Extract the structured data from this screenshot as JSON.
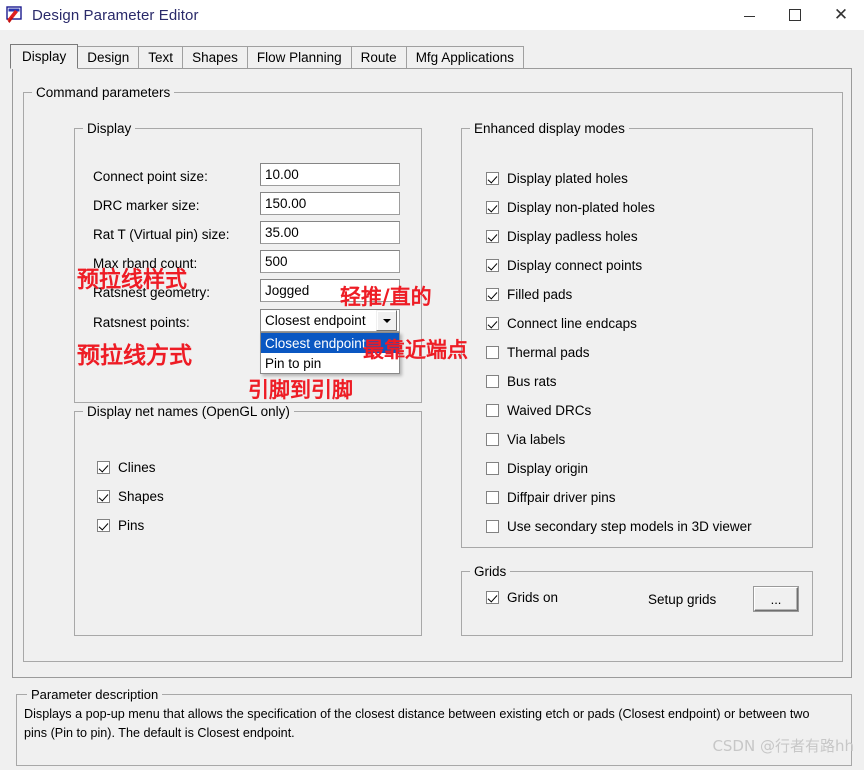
{
  "window": {
    "title": "Design Parameter Editor",
    "icon": "app-icon",
    "minimize_label": "—",
    "maximize_label": "□",
    "close_label": "✕"
  },
  "tabs": [
    {
      "label": "Display",
      "active": true
    },
    {
      "label": "Design",
      "active": false
    },
    {
      "label": "Text",
      "active": false
    },
    {
      "label": "Shapes",
      "active": false
    },
    {
      "label": "Flow Planning",
      "active": false
    },
    {
      "label": "Route",
      "active": false
    },
    {
      "label": "Mfg Applications",
      "active": false
    }
  ],
  "command_parameters": {
    "legend": "Command parameters",
    "display_group": {
      "legend": "Display",
      "fields": [
        {
          "label": "Connect point size:",
          "value": "10.00"
        },
        {
          "label": "DRC marker size:",
          "value": "150.00"
        },
        {
          "label": "Rat T (Virtual pin) size:",
          "value": "35.00"
        },
        {
          "label": "Max rband count:",
          "value": "500"
        },
        {
          "label": "Ratsnest geometry:",
          "value": "Jogged"
        }
      ],
      "ratsnest_points": {
        "label": "Ratsnest points:",
        "value": "Closest endpoint",
        "expanded": true,
        "options": [
          {
            "label": "Closest endpoint",
            "selected": true
          },
          {
            "label": "Pin to pin",
            "selected": false
          }
        ]
      }
    },
    "net_names_group": {
      "legend": "Display net names (OpenGL only)",
      "items": [
        {
          "label": "Clines",
          "checked": true
        },
        {
          "label": "Shapes",
          "checked": true
        },
        {
          "label": "Pins",
          "checked": true
        }
      ]
    },
    "enhanced_group": {
      "legend": "Enhanced display modes",
      "items": [
        {
          "label": "Display plated holes",
          "checked": true
        },
        {
          "label": "Display non-plated holes",
          "checked": true
        },
        {
          "label": "Display padless holes",
          "checked": true
        },
        {
          "label": "Display connect points",
          "checked": true
        },
        {
          "label": "Filled pads",
          "checked": true
        },
        {
          "label": "Connect line endcaps",
          "checked": true
        },
        {
          "label": "Thermal pads",
          "checked": false
        },
        {
          "label": "Bus rats",
          "checked": false
        },
        {
          "label": "Waived DRCs",
          "checked": false
        },
        {
          "label": "Via labels",
          "checked": false
        },
        {
          "label": "Display origin",
          "checked": false
        },
        {
          "label": "Diffpair driver pins",
          "checked": false
        },
        {
          "label": "Use secondary step models in 3D viewer",
          "checked": false
        }
      ]
    },
    "grids_group": {
      "legend": "Grids",
      "grids_on": {
        "label": "Grids on",
        "checked": true
      },
      "setup_grids_label": "Setup grids",
      "setup_grids_button": "..."
    }
  },
  "parameter_description": {
    "legend": "Parameter description",
    "text": "Displays a pop-up menu that allows the specification of the closest distance between existing etch or pads (Closest endpoint) or between two pins (Pin to pin). The default is Closest endpoint."
  },
  "annotations": [
    {
      "text": "预拉线样式"
    },
    {
      "text": "轻推/直的"
    },
    {
      "text": "预拉线方式"
    },
    {
      "text": "最靠近端点"
    },
    {
      "text": "引脚到引脚"
    }
  ],
  "watermark": {
    "text": "CSDN @行者有路hh"
  },
  "colors": {
    "annotation_red": "#ee1c25",
    "selection_blue": "#0a57c2",
    "dialog_face": "#f0f0f0",
    "title_text": "#2a2a6a"
  }
}
